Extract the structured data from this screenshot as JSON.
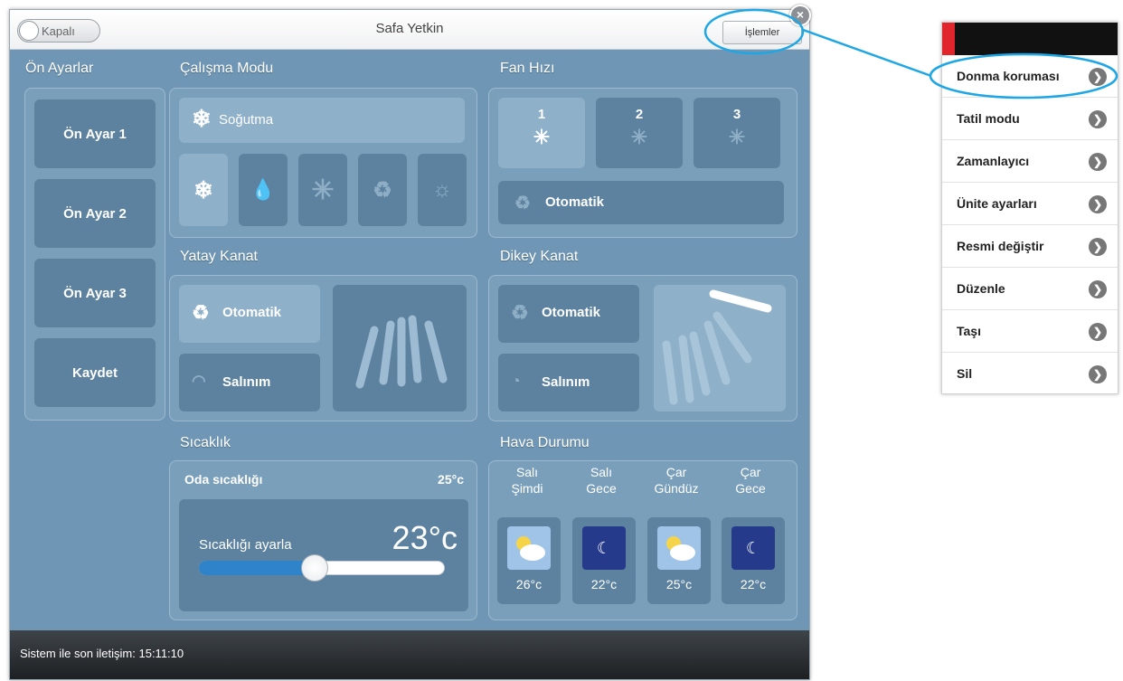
{
  "window": {
    "title": "Safa Yetkin",
    "toggle_label": "Kapalı",
    "operations_label": "İşlemler",
    "close_icon": "close-icon"
  },
  "presets": {
    "title": "Ön Ayarlar",
    "items": [
      "Ön Ayar 1",
      "Ön Ayar 2",
      "Ön Ayar 3",
      "Kaydet"
    ]
  },
  "mode": {
    "title": "Çalışma Modu",
    "selected_label": "Soğutma",
    "icons": [
      "snowflake-icon",
      "drop-icon",
      "fan-icon",
      "auto-icon",
      "sun-icon"
    ]
  },
  "fan": {
    "title": "Fan Hızı",
    "speeds": [
      "1",
      "2",
      "3"
    ],
    "auto_label": "Otomatik"
  },
  "horizontal_vane": {
    "title": "Yatay Kanat",
    "auto_label": "Otomatik",
    "swing_label": "Salınım"
  },
  "vertical_vane": {
    "title": "Dikey Kanat",
    "auto_label": "Otomatik",
    "swing_label": "Salınım"
  },
  "temperature": {
    "title": "Sıcaklık",
    "room_label": "Oda sıcaklığı",
    "room_value": "25°c",
    "set_label": "Sıcaklığı ayarla",
    "set_value": "23°c",
    "slider_fraction": 0.47
  },
  "weather": {
    "title": "Hava Durumu",
    "days": [
      {
        "day": "Salı",
        "time": "Şimdi",
        "temp": "26°c",
        "icon": "sun-cloud-icon"
      },
      {
        "day": "Salı",
        "time": "Gece",
        "temp": "22°c",
        "icon": "moon-icon"
      },
      {
        "day": "Çar",
        "time": "Gündüz",
        "temp": "25°c",
        "icon": "sun-cloud-icon"
      },
      {
        "day": "Çar",
        "time": "Gece",
        "temp": "22°c",
        "icon": "moon-icon"
      }
    ]
  },
  "footer": {
    "status": "Sistem ile son iletişim: 15:11:10"
  },
  "menu": {
    "items": [
      "Donma koruması",
      "Tatil modu",
      "Zamanlayıcı",
      "Ünite ayarları",
      "Resmi değiştir",
      "Düzenle",
      "Taşı",
      "Sil"
    ]
  },
  "colors": {
    "panel": "#6f97b5",
    "tile": "#5d82a0",
    "accent": "#2f83c9",
    "callout": "#1ea7e4",
    "menu_red": "#e0262c"
  }
}
